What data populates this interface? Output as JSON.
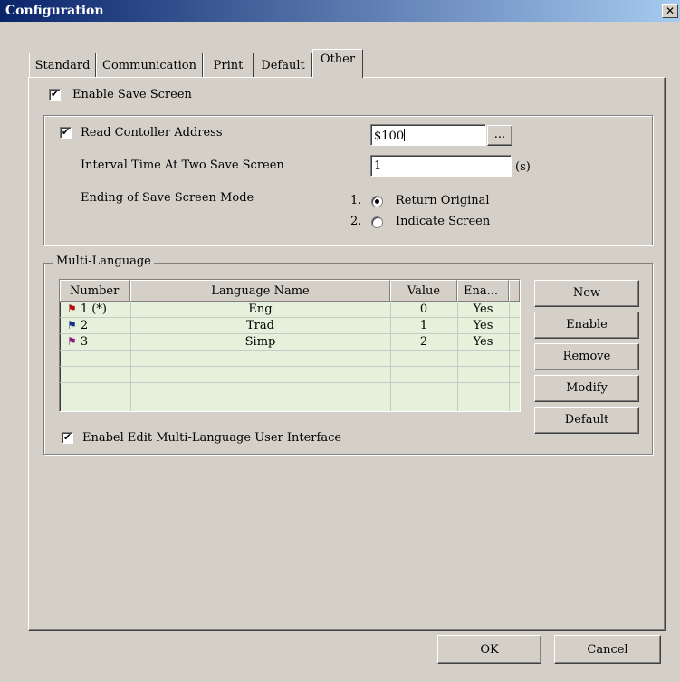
{
  "window": {
    "title": "Configuration",
    "close_glyph": "✕"
  },
  "tabs": [
    {
      "label": "Standard"
    },
    {
      "label": "Communication"
    },
    {
      "label": "Print"
    },
    {
      "label": "Default"
    },
    {
      "label": "Other"
    }
  ],
  "save_screen": {
    "enable_label": "Enable Save Screen",
    "enable_checked": true,
    "read_address_label": "Read Contoller Address",
    "read_address_checked": true,
    "address_value": "$100",
    "browse_label": "...",
    "interval_label": "Interval Time At Two Save Screen",
    "interval_value": "1",
    "interval_unit": "(s)",
    "ending_label": "Ending of Save Screen Mode",
    "mode_options": [
      {
        "num": "1.",
        "label": "Return Original",
        "selected": true
      },
      {
        "num": "2.",
        "label": "Indicate Screen",
        "selected": false
      }
    ]
  },
  "multi_language": {
    "group_title": "Multi-Language",
    "columns": [
      "Number",
      "Language Name",
      "Value",
      "Ena..."
    ],
    "rows": [
      {
        "number": "1 (*)",
        "name": "Eng",
        "value": "0",
        "enabled": "Yes",
        "flag_color": "#b01010"
      },
      {
        "number": "2",
        "name": "Trad",
        "value": "1",
        "enabled": "Yes",
        "flag_color": "#1a2a8a"
      },
      {
        "number": "3",
        "name": "Simp",
        "value": "2",
        "enabled": "Yes",
        "flag_color": "#8a1a8a"
      }
    ],
    "buttons": {
      "new": "New",
      "enable": "Enable",
      "remove": "Remove",
      "modify": "Modify",
      "default": "Default"
    },
    "edit_ui_label": "Enabel Edit Multi-Language User Interface",
    "edit_ui_checked": true
  },
  "footer": {
    "ok_label": "OK",
    "cancel_label": "Cancel"
  },
  "check_glyph": "✔",
  "flag_glyph": "⚑",
  "colors": {
    "titlebar_start": "#0a246a",
    "titlebar_end": "#a6caf0",
    "list_background": "#e6f1dc"
  }
}
